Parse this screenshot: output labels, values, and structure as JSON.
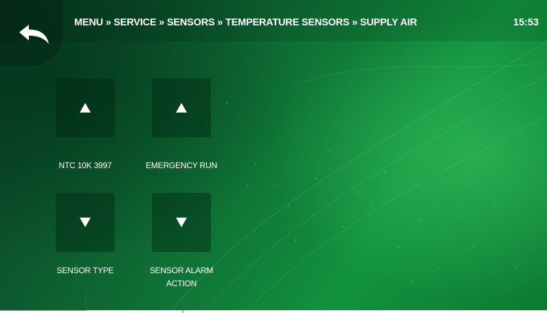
{
  "header": {
    "breadcrumb": "MENU » SERVICE » SENSORS » TEMPERATURE SENSORS » SUPPLY AIR",
    "time": "15:53",
    "back_icon": "back-arrow-icon"
  },
  "settings": [
    {
      "value": "NTC 10K 3997",
      "label": "SENSOR TYPE"
    },
    {
      "value": "EMERGENCY RUN",
      "label_line1": "SENSOR ALARM",
      "label_line2": "ACTION"
    }
  ],
  "icons": {
    "up": "triangle-up-icon",
    "down": "triangle-down-icon"
  },
  "colors": {
    "accent": "#12923e",
    "dark": "#0a3f26",
    "text": "#ffffff"
  }
}
